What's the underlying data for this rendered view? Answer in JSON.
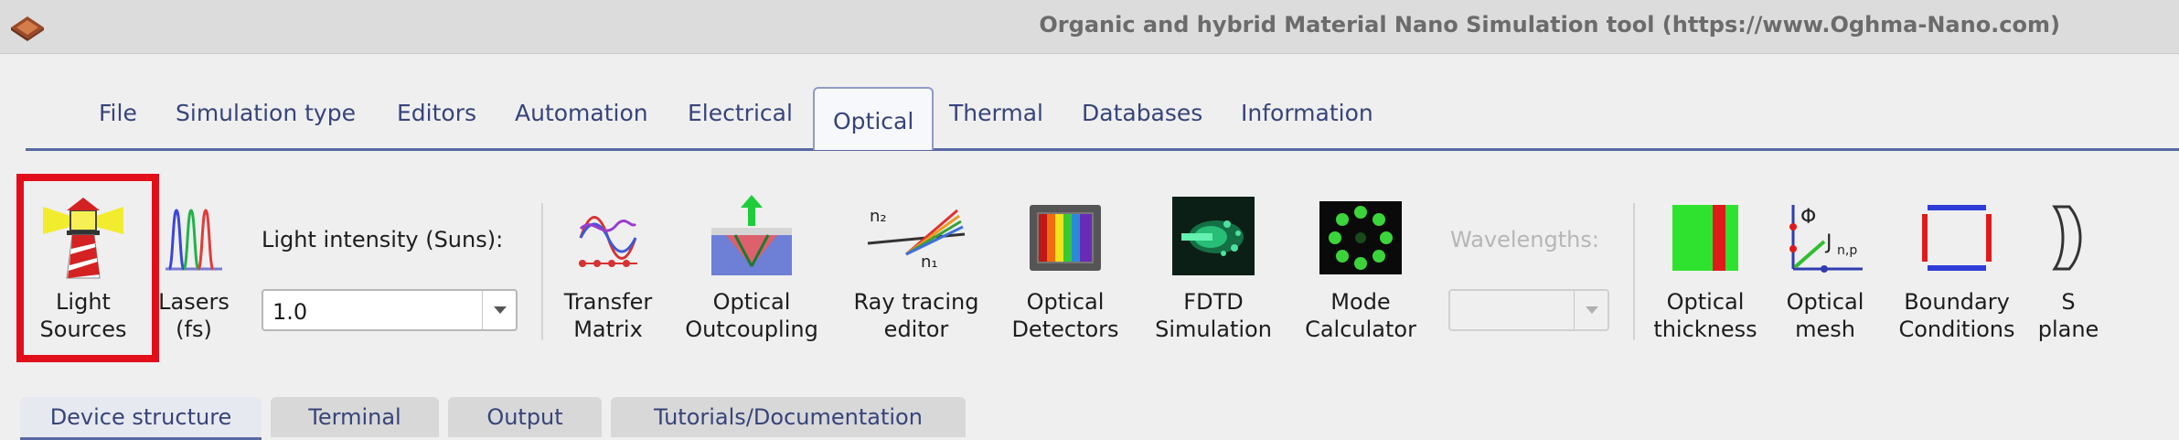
{
  "window": {
    "title": "Organic and hybrid Material Nano Simulation tool (https://www.Oghma-Nano.com)"
  },
  "menu": {
    "tabs": [
      {
        "label": "File"
      },
      {
        "label": "Simulation type"
      },
      {
        "label": "Editors"
      },
      {
        "label": "Automation"
      },
      {
        "label": "Electrical"
      },
      {
        "label": "Optical"
      },
      {
        "label": "Thermal"
      },
      {
        "label": "Databases"
      },
      {
        "label": "Information"
      }
    ],
    "active": "Optical"
  },
  "ribbon": {
    "light_sources": "Light\nSources",
    "lasers": "Lasers\n(fs)",
    "light_intensity_label": "Light intensity (Suns):",
    "light_intensity_value": "1.0",
    "transfer_matrix": "Transfer\nMatrix",
    "optical_outcoupling": "Optical\nOutcoupling",
    "ray_tracing": "Ray tracing\neditor",
    "optical_detectors": "Optical\nDetectors",
    "fdtd": "FDTD\nSimulation",
    "mode_calculator": "Mode\nCalculator",
    "wavelengths_label": "Wavelengths:",
    "wavelengths_value": "",
    "optical_thickness": "Optical\nthickness",
    "optical_mesh": "Optical\nmesh",
    "boundary_conditions": "Boundary\nConditions",
    "s_plane": "S\nplane",
    "ray_n2": "n₂",
    "ray_n1": "n₁",
    "mesh_phi": "Φ",
    "mesh_j": "J",
    "mesh_np": "n,p"
  },
  "bottom_tabs": [
    {
      "label": "Device structure"
    },
    {
      "label": "Terminal"
    },
    {
      "label": "Output"
    },
    {
      "label": "Tutorials/Documentation"
    }
  ],
  "colors": {
    "highlight": "#e20f1b",
    "menu_text": "#37447a",
    "accent_line": "#5869a3"
  }
}
